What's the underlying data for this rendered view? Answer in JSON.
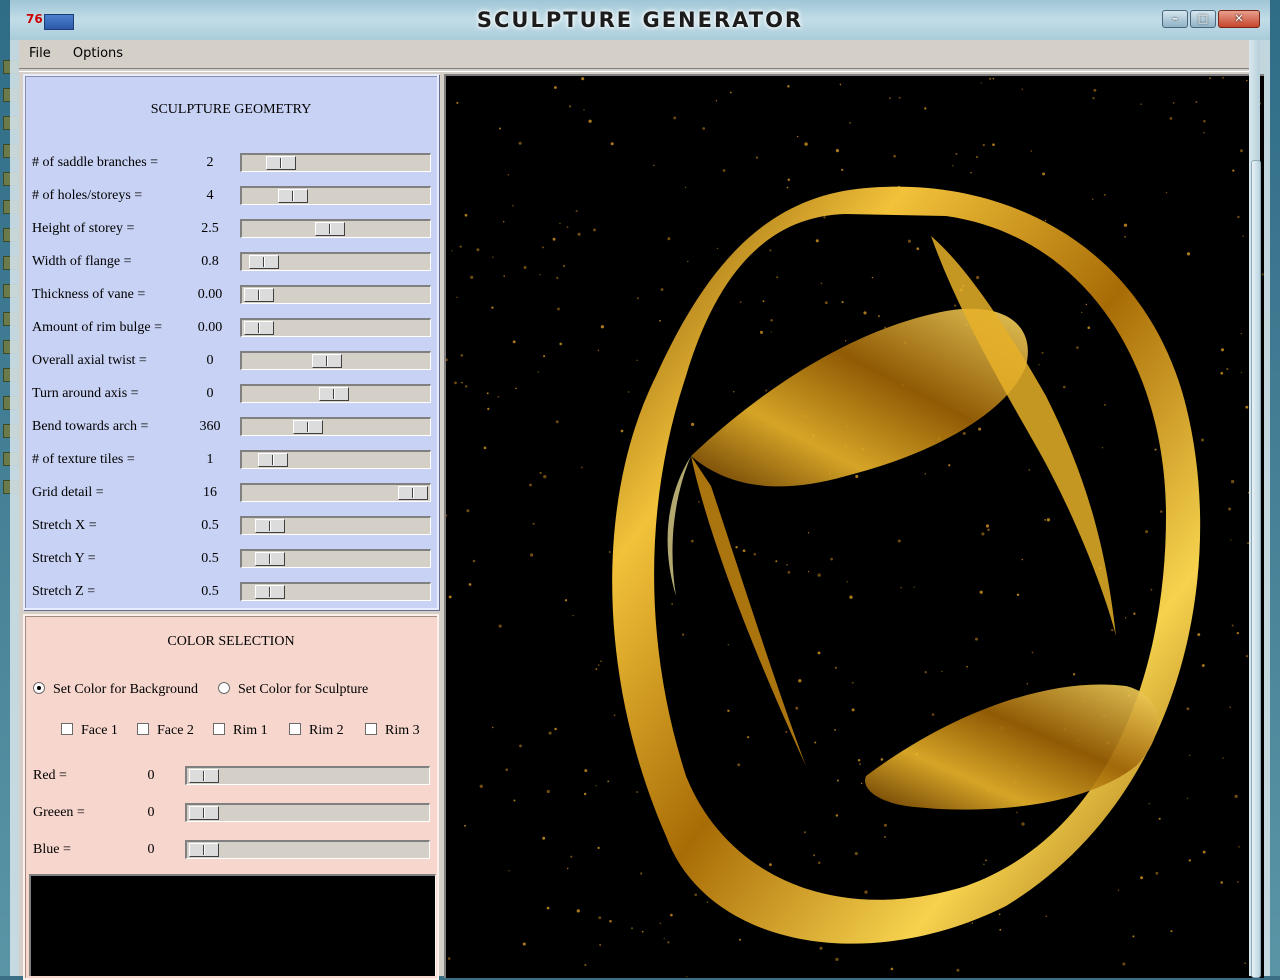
{
  "window": {
    "title": "SCULPTURE GENERATOR",
    "app_icon_text": "76",
    "buttons": [
      {
        "name": "minimize-button",
        "glyph": "–"
      },
      {
        "name": "maximize-button",
        "glyph": "□"
      },
      {
        "name": "close-button",
        "glyph": "✕"
      }
    ]
  },
  "menu": {
    "file": "File",
    "options": "Options"
  },
  "geometry": {
    "title": "SCULPTURE GEOMETRY",
    "sliders": [
      {
        "label": "# of saddle branches =",
        "value": "2",
        "level": 0.14
      },
      {
        "label": "# of holes/storeys =",
        "value": "4",
        "level": 0.22
      },
      {
        "label": "Height of storey =",
        "value": "2.5",
        "level": 0.46
      },
      {
        "label": "Width of flange =",
        "value": "0.8",
        "level": 0.03
      },
      {
        "label": "Thickness of vane =",
        "value": "0.00",
        "level": 0.0
      },
      {
        "label": "Amount of rim bulge =",
        "value": "0.00",
        "level": 0.0
      },
      {
        "label": "Overall axial twist =",
        "value": "0",
        "level": 0.44
      },
      {
        "label": "Turn around axis =",
        "value": "0",
        "level": 0.49
      },
      {
        "label": "Bend towards arch =",
        "value": "360",
        "level": 0.32
      },
      {
        "label": "# of texture tiles =",
        "value": "1",
        "level": 0.09
      },
      {
        "label": "Grid detail =",
        "value": "16",
        "level": 1.0
      },
      {
        "label": "Stretch X =",
        "value": "0.5",
        "level": 0.07
      },
      {
        "label": "Stretch Y =",
        "value": "0.5",
        "level": 0.07
      },
      {
        "label": "Stretch Z =",
        "value": "0.5",
        "level": 0.07
      }
    ]
  },
  "color": {
    "title": "COLOR SELECTION",
    "radio_background": "Set Color for Background",
    "radio_sculpture": "Set Color for Sculpture",
    "selected_radio": "background",
    "checkboxes": [
      "Face 1",
      "Face 2",
      "Rim 1",
      "Rim 2",
      "Rim 3"
    ],
    "channels": [
      {
        "label": "Red =",
        "value": "0",
        "level": 0.0
      },
      {
        "label": "Greeen =",
        "value": "0",
        "level": 0.0
      },
      {
        "label": "Blue =",
        "value": "0",
        "level": 0.0
      }
    ],
    "swatch_color": "#000000"
  },
  "colors": {
    "geometry_panel": "#c8d2f4",
    "color_panel": "#f6d6cd",
    "sculpture_gold": "#d9a514"
  }
}
